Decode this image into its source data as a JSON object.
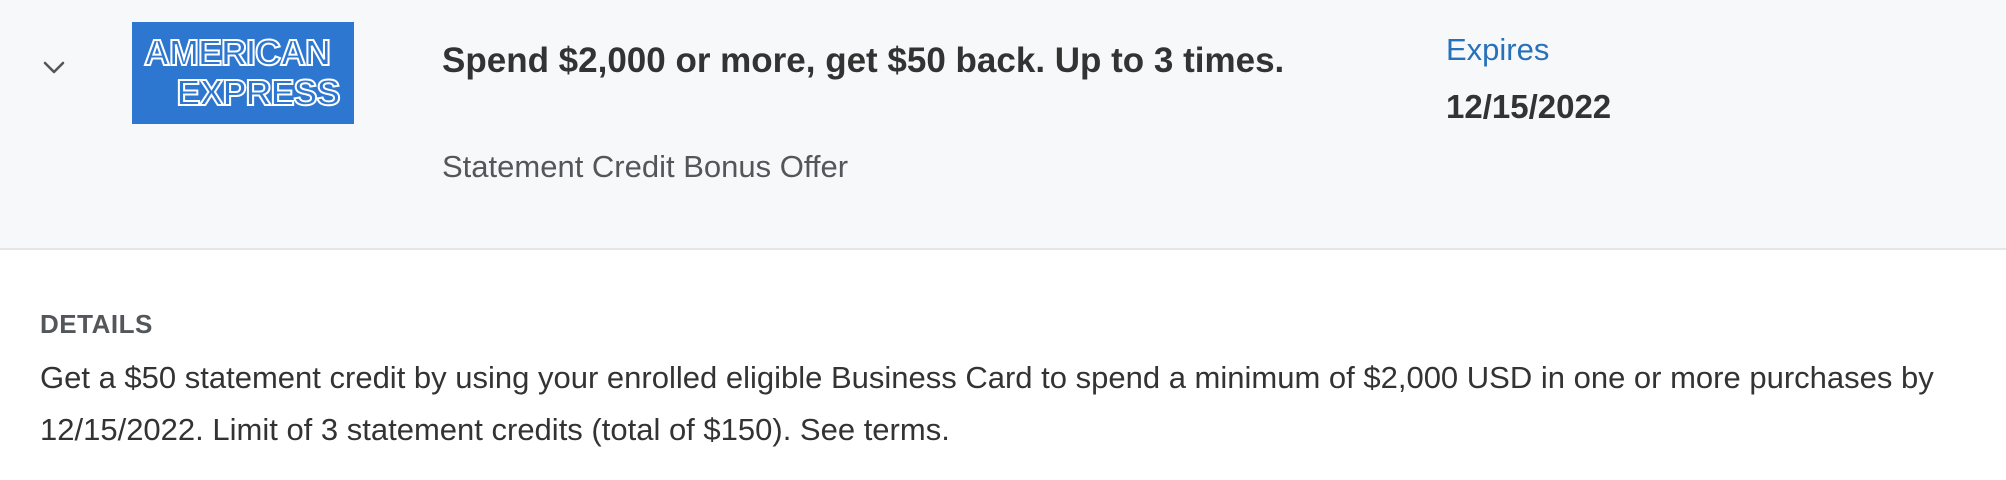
{
  "offer": {
    "logo_line_1": "AMERICAN",
    "logo_line_2": "EXPRESS",
    "title": "Spend $2,000 or more, get $50 back. Up to 3 times.",
    "subtitle": "Statement Credit Bonus Offer",
    "expires_label": "Expires",
    "expires_date": "12/15/2022",
    "toggle_icon": "chevron-down-icon"
  },
  "details": {
    "heading": "DETAILS",
    "body": "Get a $50 statement credit by using your enrolled eligible Business Card to spend a minimum of $2,000 USD in one or more purchases by 12/15/2022. Limit of 3 statement credits (total of $150). See terms."
  },
  "colors": {
    "header_bg": "#f7f8f9",
    "logo_blue": "#2e77d0",
    "link_blue": "#2671b9",
    "text_dark": "#333333",
    "text_muted": "#53565a"
  }
}
